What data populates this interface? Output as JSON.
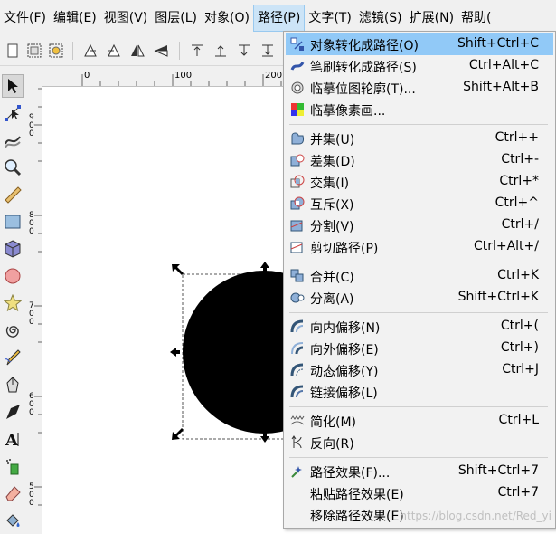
{
  "menubar": {
    "items": [
      "文件(F)",
      "编辑(E)",
      "视图(V)",
      "图层(L)",
      "对象(O)",
      "路径(P)",
      "文字(T)",
      "滤镜(S)",
      "扩展(N)",
      "帮助("
    ],
    "active_index": 5
  },
  "rulers": {
    "h_labels": [
      "0",
      "100",
      "200"
    ],
    "v_labels": [
      "900",
      "800",
      "700",
      "600",
      "500"
    ]
  },
  "path_menu": {
    "items": [
      {
        "label": "对象转化成路径(O)",
        "shortcut": "Shift+Ctrl+C",
        "icon": "object-to-path-icon",
        "highlighted": true
      },
      {
        "label": "笔刷转化成路径(S)",
        "shortcut": "Ctrl+Alt+C",
        "icon": "stroke-to-path-icon"
      },
      {
        "label": "临摹位图轮廓(T)...",
        "shortcut": "Shift+Alt+B",
        "icon": "trace-bitmap-icon"
      },
      {
        "label": "临摹像素画...",
        "shortcut": "",
        "icon": "trace-pixel-art-icon"
      },
      {
        "label": "并集(U)",
        "shortcut": "Ctrl++",
        "icon": "union-icon"
      },
      {
        "label": "差集(D)",
        "shortcut": "Ctrl+-",
        "icon": "difference-icon"
      },
      {
        "label": "交集(I)",
        "shortcut": "Ctrl+*",
        "icon": "intersection-icon"
      },
      {
        "label": "互斥(X)",
        "shortcut": "Ctrl+^",
        "icon": "exclusion-icon"
      },
      {
        "label": "分割(V)",
        "shortcut": "Ctrl+/",
        "icon": "division-icon"
      },
      {
        "label": "剪切路径(P)",
        "shortcut": "Ctrl+Alt+/",
        "icon": "cut-path-icon"
      },
      {
        "label": "合并(C)",
        "shortcut": "Ctrl+K",
        "icon": "combine-icon"
      },
      {
        "label": "分离(A)",
        "shortcut": "Shift+Ctrl+K",
        "icon": "break-apart-icon"
      },
      {
        "label": "向内偏移(N)",
        "shortcut": "Ctrl+(",
        "icon": "inset-icon"
      },
      {
        "label": "向外偏移(E)",
        "shortcut": "Ctrl+)",
        "icon": "outset-icon"
      },
      {
        "label": "动态偏移(Y)",
        "shortcut": "Ctrl+J",
        "icon": "dynamic-offset-icon"
      },
      {
        "label": "链接偏移(L)",
        "shortcut": "",
        "icon": "linked-offset-icon"
      },
      {
        "label": "简化(M)",
        "shortcut": "Ctrl+L",
        "icon": "simplify-icon"
      },
      {
        "label": "反向(R)",
        "shortcut": "",
        "icon": "reverse-icon"
      },
      {
        "label": "路径效果(F)...",
        "shortcut": "Shift+Ctrl+7",
        "icon": "path-effects-icon"
      },
      {
        "label": "粘贴路径效果(E)",
        "shortcut": "Ctrl+7",
        "icon": ""
      },
      {
        "label": "移除路径效果(E)",
        "shortcut": "",
        "icon": ""
      }
    ]
  },
  "watermark": "https://blog.csdn.net/Red_yi",
  "colors": {
    "highlight": "#91c9f7",
    "menu_bg": "#f2f2f2",
    "active_title": "#cce4f7"
  }
}
